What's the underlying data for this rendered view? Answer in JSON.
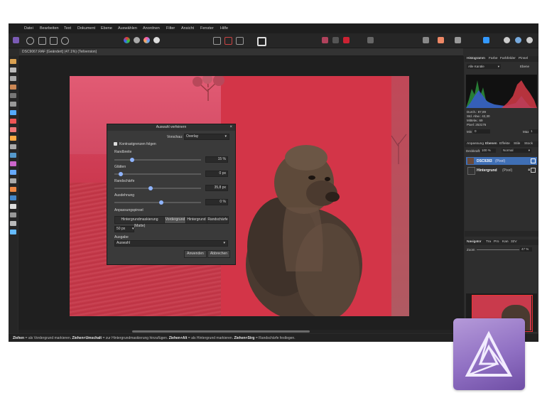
{
  "menu": [
    "Datei",
    "Bearbeiten",
    "Text",
    "Dokument",
    "Ebene",
    "Auswählen",
    "Anordnen",
    "Filter",
    "Ansicht",
    "Fenster",
    "Hilfe"
  ],
  "document": {
    "tab_title": "DSC9067.RAF [Geändert] (47.1%) (Teilversion)"
  },
  "dialog": {
    "title": "Auswahl verfeinern",
    "preview_label": "Vorschau:",
    "preview_value": "Overlay",
    "checkbox_label": "Kontrastgrenzen folgen",
    "border_label": "Randbreite",
    "border_value": "15 %",
    "smooth_label": "Glätten",
    "smooth_value": "0 px",
    "feather_label": "Randschärfe",
    "feather_value": "35,8 px",
    "ramp_label": "Ausdehnung",
    "ramp_value": "0 %",
    "brush_label": "Anpassungspinsel",
    "brush_modes": [
      "Hintergrundmaskierung (Matte)",
      "Vordergrund",
      "Hintergrund",
      "Randschärfe"
    ],
    "brush_size": "50 px",
    "output_label": "Ausgabe",
    "output_value": "Auswahl",
    "apply_label": "Anwenden",
    "cancel_label": "Abbrechen"
  },
  "panel": {
    "top_tabs": [
      "Histogramm",
      "Farbe",
      "Farbfelder",
      "Pinsel"
    ],
    "channel": "Alle Kanäle",
    "layer_toggle": "Ebene",
    "stats_labels": [
      "Durch.: 87,89",
      "Std. Abw.: 42,30",
      "Mittelw.: 69",
      "Pixel: 253176"
    ],
    "min_label": "Min",
    "min_value": "0",
    "max_label": "Max",
    "max_value": "1",
    "mid_tabs": [
      "Anpassung",
      "Ebenen",
      "Effekte",
      "Stile",
      "Stock"
    ],
    "opacity_label": "Deckkraft:",
    "opacity_value": "100 %",
    "blend_mode": "Normal",
    "layers": [
      {
        "name": "DSC9283",
        "type": "(Pixel)"
      },
      {
        "name": "Hintergrund",
        "type": "(Pixel)"
      }
    ],
    "bottom_tabs": [
      "Navigator",
      "Tra",
      "Pro",
      "Kan",
      "32V"
    ],
    "zoom_label": "Zoom",
    "zoom_value": "47 %"
  },
  "status": {
    "parts": [
      {
        "b": "Ziehen",
        "t": " = als Vordergrund markieren. "
      },
      {
        "b": "Ziehen+Umschalt",
        "t": " = zur Hintergrundmaskierung hinzufügen. "
      },
      {
        "b": "Ziehen+Alt",
        "t": " = als Hintergrund markieren. "
      },
      {
        "b": "Ziehen+Strg",
        "t": " = Randschärfe festlegen."
      }
    ]
  }
}
